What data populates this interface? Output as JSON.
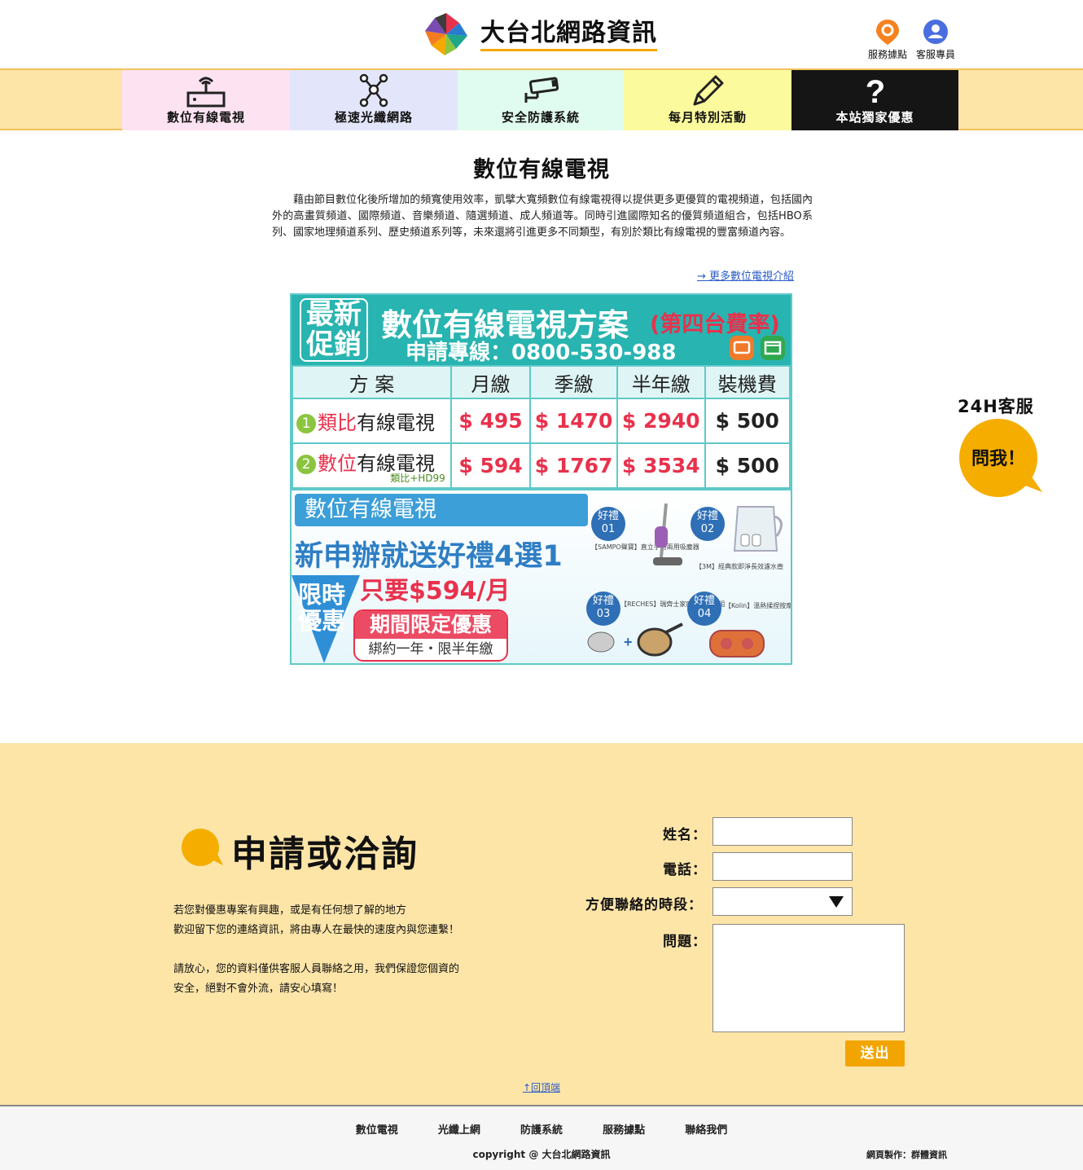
{
  "header": {
    "site_name": "大台北網路資訊",
    "links": [
      {
        "label": "服務據點",
        "icon": "location-pin-icon",
        "color": "#f5821f"
      },
      {
        "label": "客服專員",
        "icon": "user-icon",
        "color": "#4a6ee0"
      }
    ]
  },
  "nav": {
    "items": [
      {
        "label": "數位有線電視",
        "icon": "router-icon",
        "bg": "#fde3f2"
      },
      {
        "label": "極速光纖網路",
        "icon": "network-icon",
        "bg": "#e3e6fb"
      },
      {
        "label": "安全防護系統",
        "icon": "camera-icon",
        "bg": "#e0fbef"
      },
      {
        "label": "每月特別活動",
        "icon": "pencil-icon",
        "bg": "#fbfb9e"
      },
      {
        "label": "本站獨家優惠",
        "icon": "question-icon",
        "bg": "#151515"
      }
    ]
  },
  "main": {
    "title": "數位有線電視",
    "intro": "藉由節目數位化後所增加的頻寬使用效率，凱擘大寬頻數位有線電視得以提供更多更優質的電視頻道，包括國內外的高畫質頻道、國際頻道、音樂頻道、隨選頻道、成人頻道等。同時引進國際知名的優質頻道組合，包括HBO系列、國家地理頻道系列、歷史頻道系列等，未來還將引進更多不同類型，有別於類比有線電視的豐富頻道內容。",
    "more_link": "→ 更多數位電視介紹"
  },
  "promo": {
    "badge": "最新促銷",
    "badge_line1": "最新",
    "badge_line2": "促銷",
    "title": "數位有線電視方案",
    "subtitle": "(第四台費率)",
    "phone": "申請專線：0800-530-988",
    "headers": [
      "方 案",
      "月繳",
      "季繳",
      "半年繳",
      "裝機費"
    ],
    "plans": [
      {
        "num": "1",
        "name_hl": "類比",
        "name_rest": "有線電視",
        "note": "",
        "monthly": "$ 495",
        "quarterly": "$ 1470",
        "half_year": "$ 2940",
        "install": "$ 500"
      },
      {
        "num": "2",
        "name_hl": "數位",
        "name_rest": "有線電視",
        "note": "類比+HD99",
        "monthly": "$ 594",
        "quarterly": "$ 1767",
        "half_year": "$ 3534",
        "install": "$ 500"
      }
    ],
    "gift_title": "數位有線電視",
    "gift_line": "新申辦就送好禮4選1",
    "limited_1": "限時",
    "limited_2": "優惠",
    "price_text": "只要$594/月",
    "period_title": "期間限定優惠",
    "period_sub": "綁約一年・限半年繳",
    "gifts": [
      {
        "badge": "好禮01",
        "caption": "【SAMPO聲寶】直立手持兩用吸塵器"
      },
      {
        "badge": "好禮02",
        "caption": "【3M】經典款即淨長效濾水壺"
      },
      {
        "badge": "好禮03",
        "caption": "【RECHES】瑞齊士家庭超值雙鍋組"
      },
      {
        "badge": "好禮04",
        "caption": "【Kolin】溫熱揉捏按摩器"
      }
    ]
  },
  "chat": {
    "title": "24H客服",
    "button": "問我！",
    "color": "#f5ad00"
  },
  "contact": {
    "title": "申請或洽詢",
    "para1_l1": "若您對優惠專案有興趣，或是有任何想了解的地方",
    "para1_l2": "歡迎留下您的連絡資訊，將由專人在最快的速度內與您連繫！",
    "para2_l1": "請放心，您的資料僅供客服人員聯絡之用，我們保證您個資的",
    "para2_l2": "安全，絕對不會外流，請安心填寫！",
    "name_label": "姓名：",
    "phone_label": "電話：",
    "time_label": "方便聯絡的時段：",
    "question_label": "問題：",
    "name_value": "",
    "phone_value": "",
    "time_value": "",
    "question_value": "",
    "submit": "送出",
    "back_to_top": "↑回頂端"
  },
  "footer": {
    "links": [
      "數位電視",
      "光纖上網",
      "防護系統",
      "服務據點",
      "聯絡我們"
    ],
    "copyright": "copyright @ 大台北網路資訊",
    "made_by": "網頁製作：群體資訊"
  },
  "colors": {
    "accent_orange": "#f5a800",
    "nav_band": "#fde5a8",
    "promo_teal": "#28b4b0",
    "price_red": "#e8314c"
  }
}
